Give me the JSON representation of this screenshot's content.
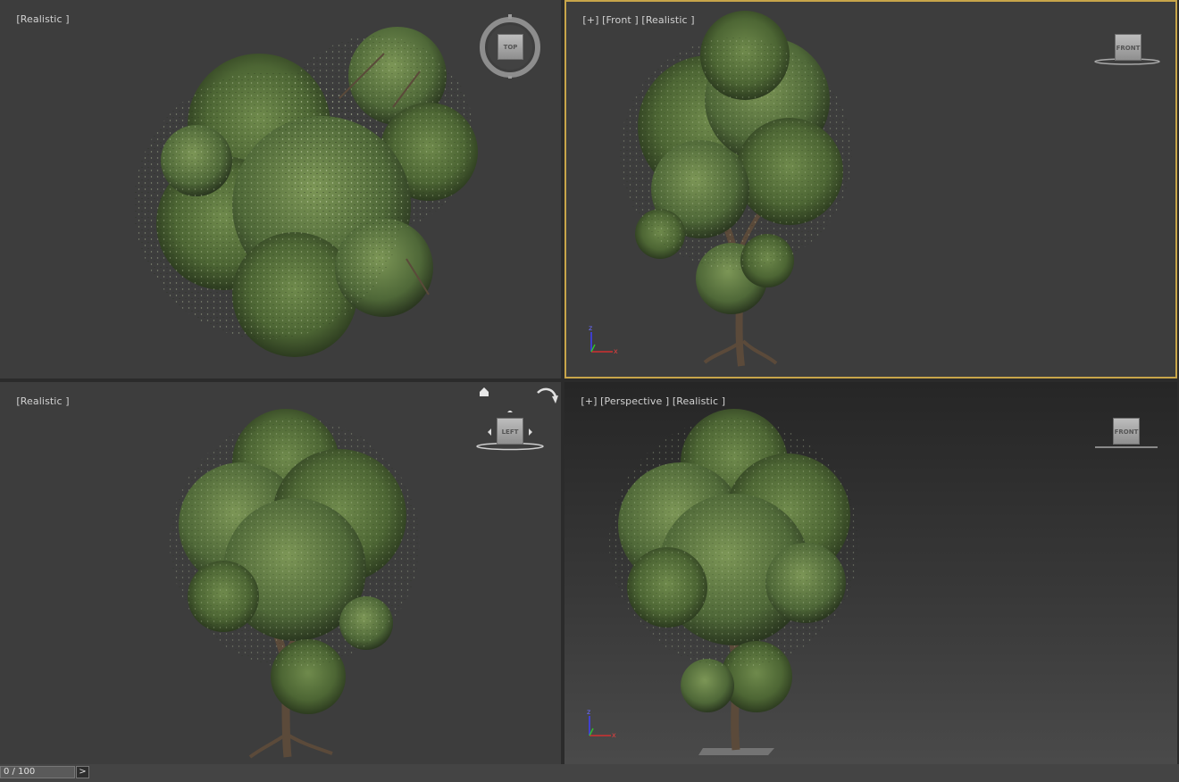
{
  "viewports": {
    "top": {
      "label_parts": [
        "[",
        "Realistic",
        " ]"
      ],
      "viewcube": "TOP"
    },
    "front": {
      "label_parts": [
        "[+]",
        " [",
        "Front",
        " ] [",
        "Realistic",
        " ]"
      ],
      "viewcube": "FRONT"
    },
    "left": {
      "label_parts": [
        "[",
        "Realistic",
        " ]"
      ],
      "viewcube": "LEFT"
    },
    "perspective": {
      "label_parts": [
        "[+]",
        " [",
        "Perspective",
        " ] [",
        "Realistic",
        " ]"
      ],
      "viewcube": "FRONT"
    }
  },
  "axis_labels": {
    "z": "z",
    "x": "x",
    "y": "y"
  },
  "timeline": {
    "frame_display": "0 / 100",
    "next_label": ">"
  },
  "colors": {
    "active_viewport_border": "#c8a54a",
    "foliage": "#4d6634",
    "trunk": "#5b4a3a"
  }
}
